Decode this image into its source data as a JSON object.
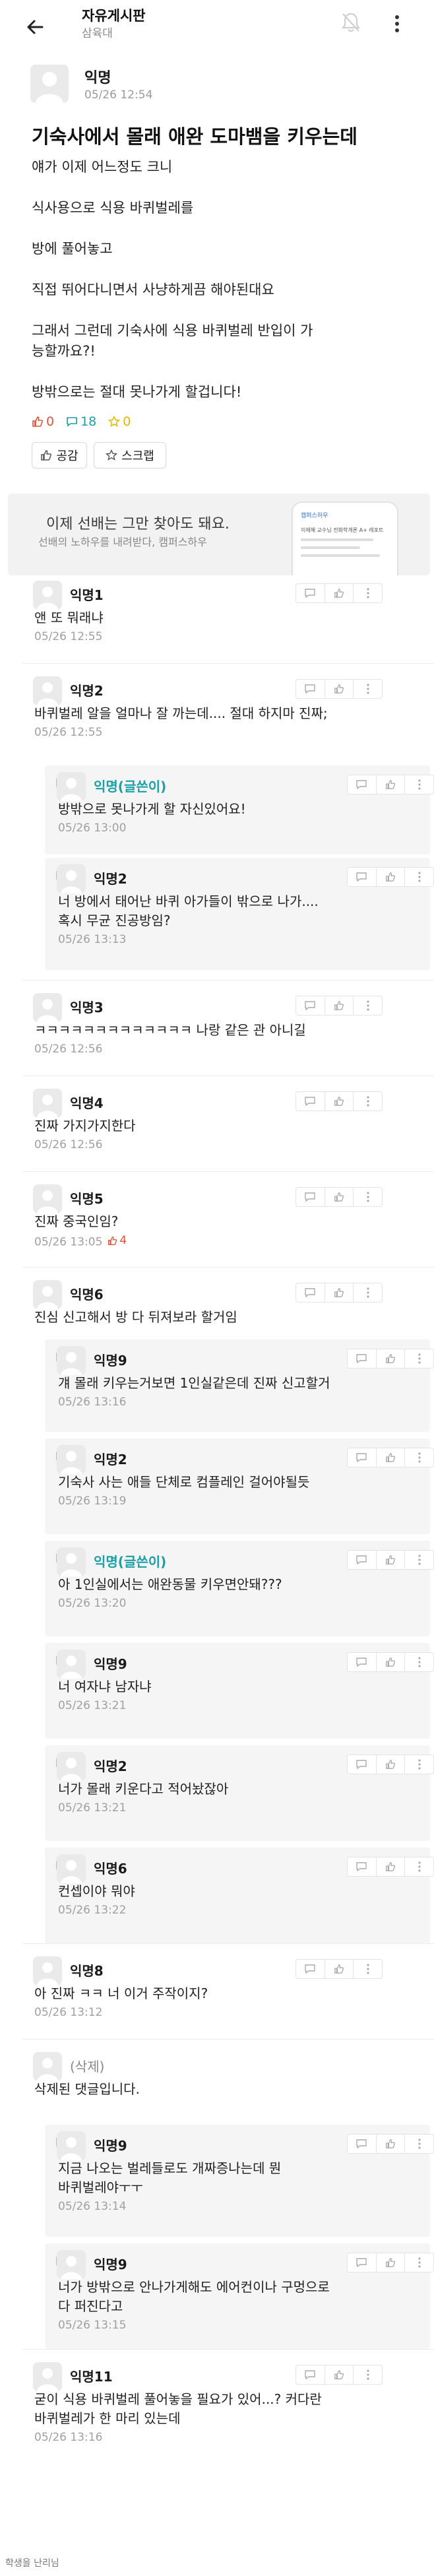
{
  "header": {
    "title": "자유게시판",
    "subtitle": "삼육대"
  },
  "post": {
    "author": "익명",
    "date": "05/26 12:54",
    "title": "기숙사에서 몰래 애완 도마뱀을 키우는데",
    "body": [
      "얘가 이제 어느정도 크니",
      "식사용으로 식용 바퀴벌레를",
      "방에 풀어놓고",
      "직접 뛰어다니면서 사냥하게끔 해야된대요",
      "그래서 그런데 기숙사에 식용 바퀴벌레 반입이 가능할까요?!",
      "방밖으로는 절대 못나가게 할겁니다!"
    ],
    "likes": "0",
    "comments": "18",
    "scraps": "0",
    "like_button": "공감",
    "scrap_button": "스크랩"
  },
  "banner": {
    "title": "이제 선배는 그만 찾아도 돼요.",
    "subtitle": "선배의 노하우를 내려받다, 캠퍼스하우",
    "phone_title": "캠퍼스하우",
    "phone_text": "이제혜 교수님 전화학개론 A+ 레포트"
  },
  "comments": [
    {
      "author": "익명1",
      "text": [
        "앤 또 뭐래냐"
      ],
      "date": "05/26 12:55"
    },
    {
      "author": "익명2",
      "text": [
        "바퀴벌레 알을 얼마나 잘 까는데.... 절대 하지마 진짜;"
      ],
      "date": "05/26 12:55"
    },
    {
      "author": "익명(글쓴이)",
      "text": [
        "방밖으로 못나가게 할 자신있어요!"
      ],
      "date": "05/26 13:00"
    },
    {
      "author": "익명2",
      "text": [
        "너 방에서 태어난 바퀴 아가들이 밖으로 나가....",
        "혹시 무균 진공방임?"
      ],
      "date": "05/26 13:13"
    },
    {
      "author": "익명3",
      "text": [
        "ㅋㅋㅋㅋㅋㅋㅋㅋㅋㅋㅋㅋㅋ 나랑 같은 관 아니길"
      ],
      "date": "05/26 12:56"
    },
    {
      "author": "익명4",
      "text": [
        "진짜 가지가지한다"
      ],
      "date": "05/26 12:56"
    },
    {
      "author": "익명5",
      "text": [
        "진짜 중국인임?"
      ],
      "date": "05/26 13:05",
      "likes": "4"
    },
    {
      "author": "익명6",
      "text": [
        "진심 신고해서 방 다 뒤져보라 할거임"
      ],
      "date": ""
    },
    {
      "author": "익명9",
      "text": [
        "걔 몰래 키우는거보면 1인실같은데 진짜 신고할거"
      ],
      "date": "05/26 13:16"
    },
    {
      "author": "익명2",
      "text": [
        "기숙사 사는 애들 단체로 컴플레인 걸어야될듯"
      ],
      "date": "05/26 13:19"
    },
    {
      "author": "익명(글쓴이)",
      "text": [
        "아 1인실에서는 애완동물 키우면안돼???"
      ],
      "date": "05/26 13:20"
    },
    {
      "author": "익명9",
      "text": [
        "너 여자냐 남자냐"
      ],
      "date": "05/26 13:21"
    },
    {
      "author": "익명2",
      "text": [
        "너가 몰래 키운다고 적어놨잖아"
      ],
      "date": "05/26 13:21"
    },
    {
      "author": "익명6",
      "text": [
        "컨셉이야 뭐야"
      ],
      "date": "05/26 13:22"
    },
    {
      "author": "익명8",
      "text": [
        "아 진짜 ㅋㅋ 너 이거 주작이지?"
      ],
      "date": "05/26 13:12"
    },
    {
      "author": "(삭제)",
      "text": [
        "삭제된 댓글입니다."
      ],
      "date": ""
    },
    {
      "author": "익명9",
      "text": [
        "지금 나오는 벌레들로도 개짜증나는데 뭔",
        "바퀴벌레야ㅜㅜ"
      ],
      "date": "05/26 13:14"
    },
    {
      "author": "익명9",
      "text": [
        "너가 방밖으로 안나가게해도 에어컨이나 구멍으로",
        "다 퍼진다고"
      ],
      "date": "05/26 13:15"
    },
    {
      "author": "익명11",
      "text": [
        "굳이 식용 바퀴벌레 풀어놓을 필요가 있어...? 커다란",
        "바퀴벌레가 한 마리 있는데"
      ],
      "date": "05/26 13:16"
    }
  ],
  "footer": {
    "note": "학생을 난리님"
  },
  "colors": {
    "op_author": "#1b9fa7",
    "like_red": "#e0533a",
    "comment_blue": "#1b9fa7",
    "scrap_yellow": "#e6b800"
  }
}
